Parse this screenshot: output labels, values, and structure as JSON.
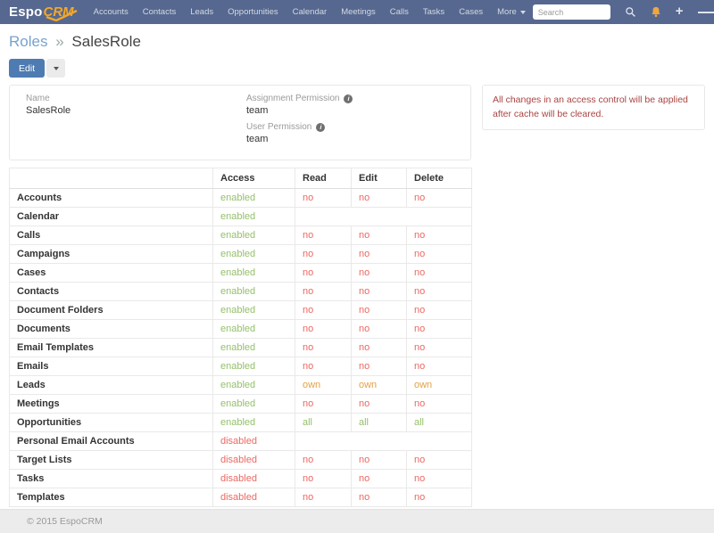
{
  "navbar": {
    "logo_espo": "Espo",
    "logo_crm": "CRM",
    "items": [
      "Accounts",
      "Contacts",
      "Leads",
      "Opportunities",
      "Calendar",
      "Meetings",
      "Calls",
      "Tasks",
      "Cases"
    ],
    "more_label": "More",
    "search_placeholder": "Search"
  },
  "header": {
    "breadcrumb_parent": "Roles",
    "breadcrumb_separator": "»",
    "title": "SalesRole"
  },
  "toolbar": {
    "edit_label": "Edit"
  },
  "overview": {
    "name_label": "Name",
    "name_value": "SalesRole",
    "assignment_permission_label": "Assignment Permission",
    "assignment_permission_value": "team",
    "user_permission_label": "User Permission",
    "user_permission_value": "team",
    "info_glyph": "i"
  },
  "notice": {
    "text": "All changes in an access control will be applied after cache will be cleared."
  },
  "access_table": {
    "headers": {
      "scope": "",
      "access": "Access",
      "read": "Read",
      "edit": "Edit",
      "delete": "Delete"
    },
    "rows": [
      {
        "name": "Accounts",
        "access": "enabled",
        "read": "no",
        "edit": "no",
        "delete": "no"
      },
      {
        "name": "Calendar",
        "access": "enabled",
        "read": "",
        "edit": "",
        "delete": ""
      },
      {
        "name": "Calls",
        "access": "enabled",
        "read": "no",
        "edit": "no",
        "delete": "no"
      },
      {
        "name": "Campaigns",
        "access": "enabled",
        "read": "no",
        "edit": "no",
        "delete": "no"
      },
      {
        "name": "Cases",
        "access": "enabled",
        "read": "no",
        "edit": "no",
        "delete": "no"
      },
      {
        "name": "Contacts",
        "access": "enabled",
        "read": "no",
        "edit": "no",
        "delete": "no"
      },
      {
        "name": "Document Folders",
        "access": "enabled",
        "read": "no",
        "edit": "no",
        "delete": "no"
      },
      {
        "name": "Documents",
        "access": "enabled",
        "read": "no",
        "edit": "no",
        "delete": "no"
      },
      {
        "name": "Email Templates",
        "access": "enabled",
        "read": "no",
        "edit": "no",
        "delete": "no"
      },
      {
        "name": "Emails",
        "access": "enabled",
        "read": "no",
        "edit": "no",
        "delete": "no"
      },
      {
        "name": "Leads",
        "access": "enabled",
        "read": "own",
        "edit": "own",
        "delete": "own"
      },
      {
        "name": "Meetings",
        "access": "enabled",
        "read": "no",
        "edit": "no",
        "delete": "no"
      },
      {
        "name": "Opportunities",
        "access": "enabled",
        "read": "all",
        "edit": "all",
        "delete": "all"
      },
      {
        "name": "Personal Email Accounts",
        "access": "disabled",
        "read": "",
        "edit": "",
        "delete": ""
      },
      {
        "name": "Target Lists",
        "access": "disabled",
        "read": "no",
        "edit": "no",
        "delete": "no"
      },
      {
        "name": "Tasks",
        "access": "disabled",
        "read": "no",
        "edit": "no",
        "delete": "no"
      },
      {
        "name": "Templates",
        "access": "disabled",
        "read": "no",
        "edit": "no",
        "delete": "no"
      }
    ]
  },
  "value_colors": {
    "enabled": "#95c06b",
    "disabled": "#eb6962",
    "no": "#eb6962",
    "own": "#e2a147",
    "all": "#95c06b"
  },
  "footer": {
    "copyright": "© 2015 EspoCRM"
  }
}
